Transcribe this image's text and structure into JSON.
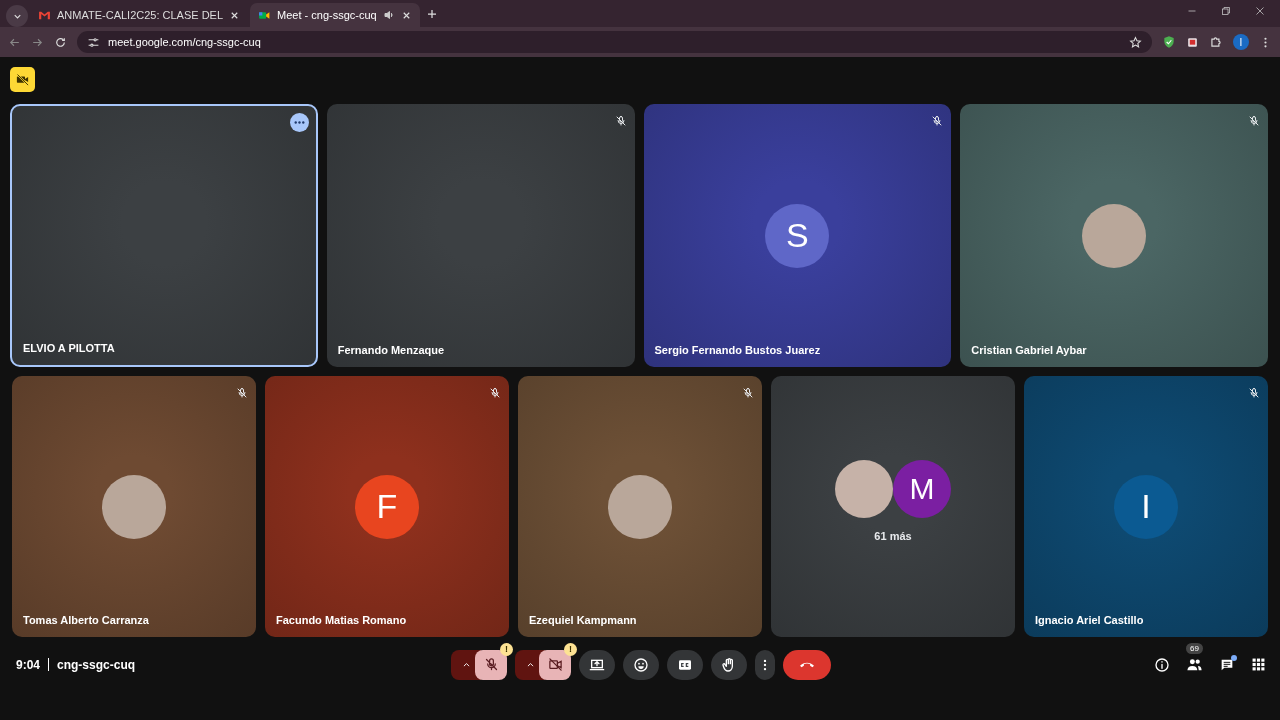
{
  "browser": {
    "tabs": [
      {
        "title": "ANMATE-CALI2C25: CLASE DEL",
        "selected": false,
        "kind": "mail",
        "audio": false
      },
      {
        "title": "Meet - cng-ssgc-cuq",
        "selected": true,
        "kind": "meet",
        "audio": true
      }
    ],
    "url": "meet.google.com/cng-ssgc-cuq",
    "profile": "I"
  },
  "tiles_top": [
    {
      "name": "ELVIO A PILOTTA",
      "kind": "blank",
      "highlighted": true,
      "muted": false,
      "color": "#3c4043"
    },
    {
      "name": "Fernando Menzaque",
      "kind": "blank",
      "highlighted": false,
      "muted": true,
      "color": "#3c4043"
    },
    {
      "name": "Sergio Fernando Bustos Juarez",
      "kind": "letter",
      "avatar": {
        "letter": "S",
        "color": "#5f67c8"
      },
      "highlighted": false,
      "muted": true,
      "color": "#3a3f9c"
    },
    {
      "name": "Cristian Gabriel Aybar",
      "kind": "photo",
      "highlighted": false,
      "muted": true,
      "color": "#4b6664"
    }
  ],
  "tiles_bottom": [
    {
      "name": "Tomas Alberto Carranza",
      "kind": "photo",
      "highlighted": false,
      "muted": true,
      "color": "#6e4a32"
    },
    {
      "name": "Facundo Matias Romano",
      "kind": "letter",
      "avatar": {
        "letter": "F",
        "color": "#e8451f"
      },
      "highlighted": false,
      "muted": true,
      "color": "#8e301d"
    },
    {
      "name": "Ezequiel Kampmann",
      "kind": "photo",
      "highlighted": false,
      "muted": true,
      "color": "#6d5036"
    },
    {
      "kind": "overflow",
      "avatar": {
        "letter": "M",
        "color": "#7b1fa2"
      },
      "caption": "61 más",
      "highlighted": false,
      "muted": false,
      "color": "#3c4043"
    },
    {
      "name": "Ignacio Ariel Castillo",
      "kind": "letter",
      "avatar": {
        "letter": "I",
        "color": "#0b5a92"
      },
      "highlighted": false,
      "muted": true,
      "color": "#0e4a72"
    }
  ],
  "footer": {
    "time": "9:04",
    "meeting_code": "cng-ssgc-cuq",
    "controls": [
      {
        "kind": "mic",
        "on": false,
        "alert": "!"
      },
      {
        "kind": "camera",
        "on": false,
        "alert": "!"
      },
      {
        "kind": "present"
      },
      {
        "kind": "emoji"
      },
      {
        "kind": "captions"
      },
      {
        "kind": "hand"
      },
      {
        "kind": "more"
      },
      {
        "kind": "end"
      }
    ],
    "participants_count": "69",
    "chat_unread": true
  }
}
